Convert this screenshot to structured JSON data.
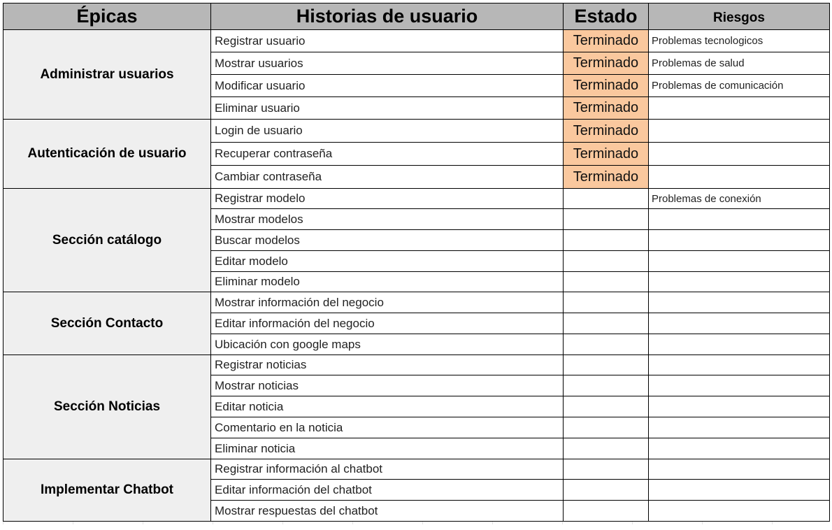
{
  "headers": {
    "epicas": "Épicas",
    "historias": "Historias de usuario",
    "estado": "Estado",
    "riesgos": "Riesgos"
  },
  "colors": {
    "header_bg": "#b7b7b7",
    "epic_bg": "#efefef",
    "done_bg": "#fac89e"
  },
  "epics": [
    {
      "name": "Administrar usuarios",
      "stories": [
        {
          "story": "Registrar usuario",
          "estado": "Terminado",
          "riesgo": "Problemas tecnologicos"
        },
        {
          "story": "Mostrar usuarios",
          "estado": "Terminado",
          "riesgo": "Problemas de salud"
        },
        {
          "story": "Modificar usuario",
          "estado": "Terminado",
          "riesgo": "Problemas de comunicación"
        },
        {
          "story": "Eliminar usuario",
          "estado": "Terminado",
          "riesgo": ""
        }
      ]
    },
    {
      "name": "Autenticación de usuario",
      "stories": [
        {
          "story": "Login de usuario",
          "estado": "Terminado",
          "riesgo": ""
        },
        {
          "story": "Recuperar contraseña",
          "estado": "Terminado",
          "riesgo": ""
        },
        {
          "story": "Cambiar contraseña",
          "estado": "Terminado",
          "riesgo": ""
        }
      ]
    },
    {
      "name": "Sección catálogo",
      "stories": [
        {
          "story": "Registrar modelo",
          "estado": "",
          "riesgo": "Problemas de conexión"
        },
        {
          "story": "Mostrar modelos",
          "estado": "",
          "riesgo": ""
        },
        {
          "story": "Buscar modelos",
          "estado": "",
          "riesgo": ""
        },
        {
          "story": "Editar modelo",
          "estado": "",
          "riesgo": ""
        },
        {
          "story": "Eliminar modelo",
          "estado": "",
          "riesgo": ""
        }
      ]
    },
    {
      "name": "Sección Contacto",
      "stories": [
        {
          "story": "Mostrar información del negocio",
          "estado": "",
          "riesgo": ""
        },
        {
          "story": "Editar información del negocio",
          "estado": "",
          "riesgo": ""
        },
        {
          "story": "Ubicación con google maps",
          "estado": "",
          "riesgo": ""
        }
      ]
    },
    {
      "name": "Sección Noticias",
      "stories": [
        {
          "story": "Registrar noticias",
          "estado": "",
          "riesgo": ""
        },
        {
          "story": "Mostrar noticias",
          "estado": "",
          "riesgo": ""
        },
        {
          "story": "Editar noticia",
          "estado": "",
          "riesgo": ""
        },
        {
          "story": "Comentario en la noticia",
          "estado": "",
          "riesgo": ""
        },
        {
          "story": "Eliminar noticia",
          "estado": "",
          "riesgo": ""
        }
      ]
    },
    {
      "name": "Implementar Chatbot",
      "stories": [
        {
          "story": "Registrar información al chatbot",
          "estado": "",
          "riesgo": ""
        },
        {
          "story": "Editar información del chatbot",
          "estado": "",
          "riesgo": ""
        },
        {
          "story": "Mostrar respuestas del chatbot",
          "estado": "",
          "riesgo": ""
        }
      ]
    }
  ]
}
